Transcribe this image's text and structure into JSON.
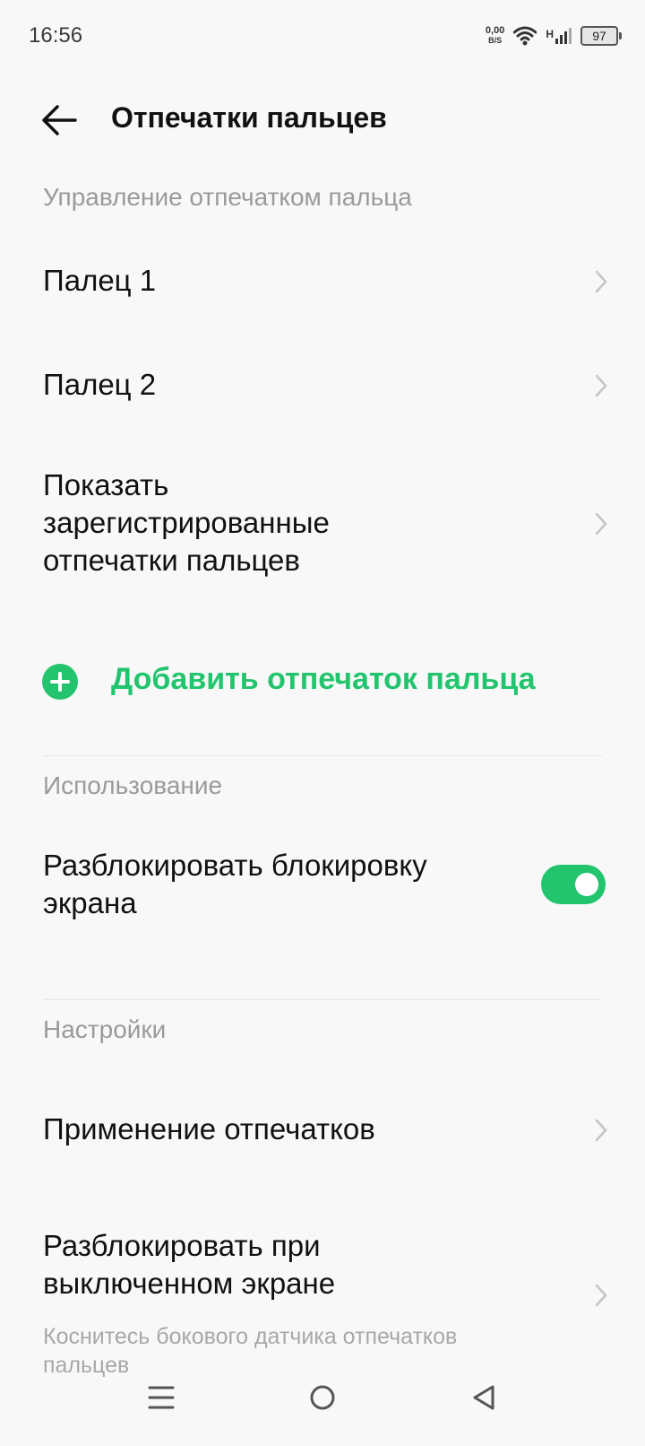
{
  "status": {
    "time": "16:56",
    "net_speed_value": "0,00",
    "net_speed_unit": "B/S",
    "network_type": "H",
    "battery": "97"
  },
  "header": {
    "title": "Отпечатки пальцев"
  },
  "sections": {
    "management": "Управление отпечатком пальца",
    "usage": "Использование",
    "settings": "Настройки"
  },
  "fingers": [
    {
      "label": "Палец 1"
    },
    {
      "label": "Палец 2"
    }
  ],
  "show_registered": "Показать зарегистрированные отпечатки пальцев",
  "add_fingerprint": "Добавить отпечаток пальца",
  "unlock_screen": {
    "label": "Разблокировать блокировку экрана",
    "enabled": true
  },
  "apply_fingerprints": "Применение отпечатков",
  "unlock_screen_off": {
    "label": "Разблокировать при выключенном экране",
    "subtitle": "Коснитесь бокового датчика отпечатков пальцев"
  },
  "colors": {
    "accent": "#22c56e",
    "background": "#f8f8f8"
  },
  "icons": [
    "back-arrow-icon",
    "chevron-right-icon",
    "plus-circle-icon",
    "wifi-icon",
    "signal-icon",
    "battery-icon",
    "menu-icon",
    "home-icon",
    "back-triangle-icon"
  ]
}
